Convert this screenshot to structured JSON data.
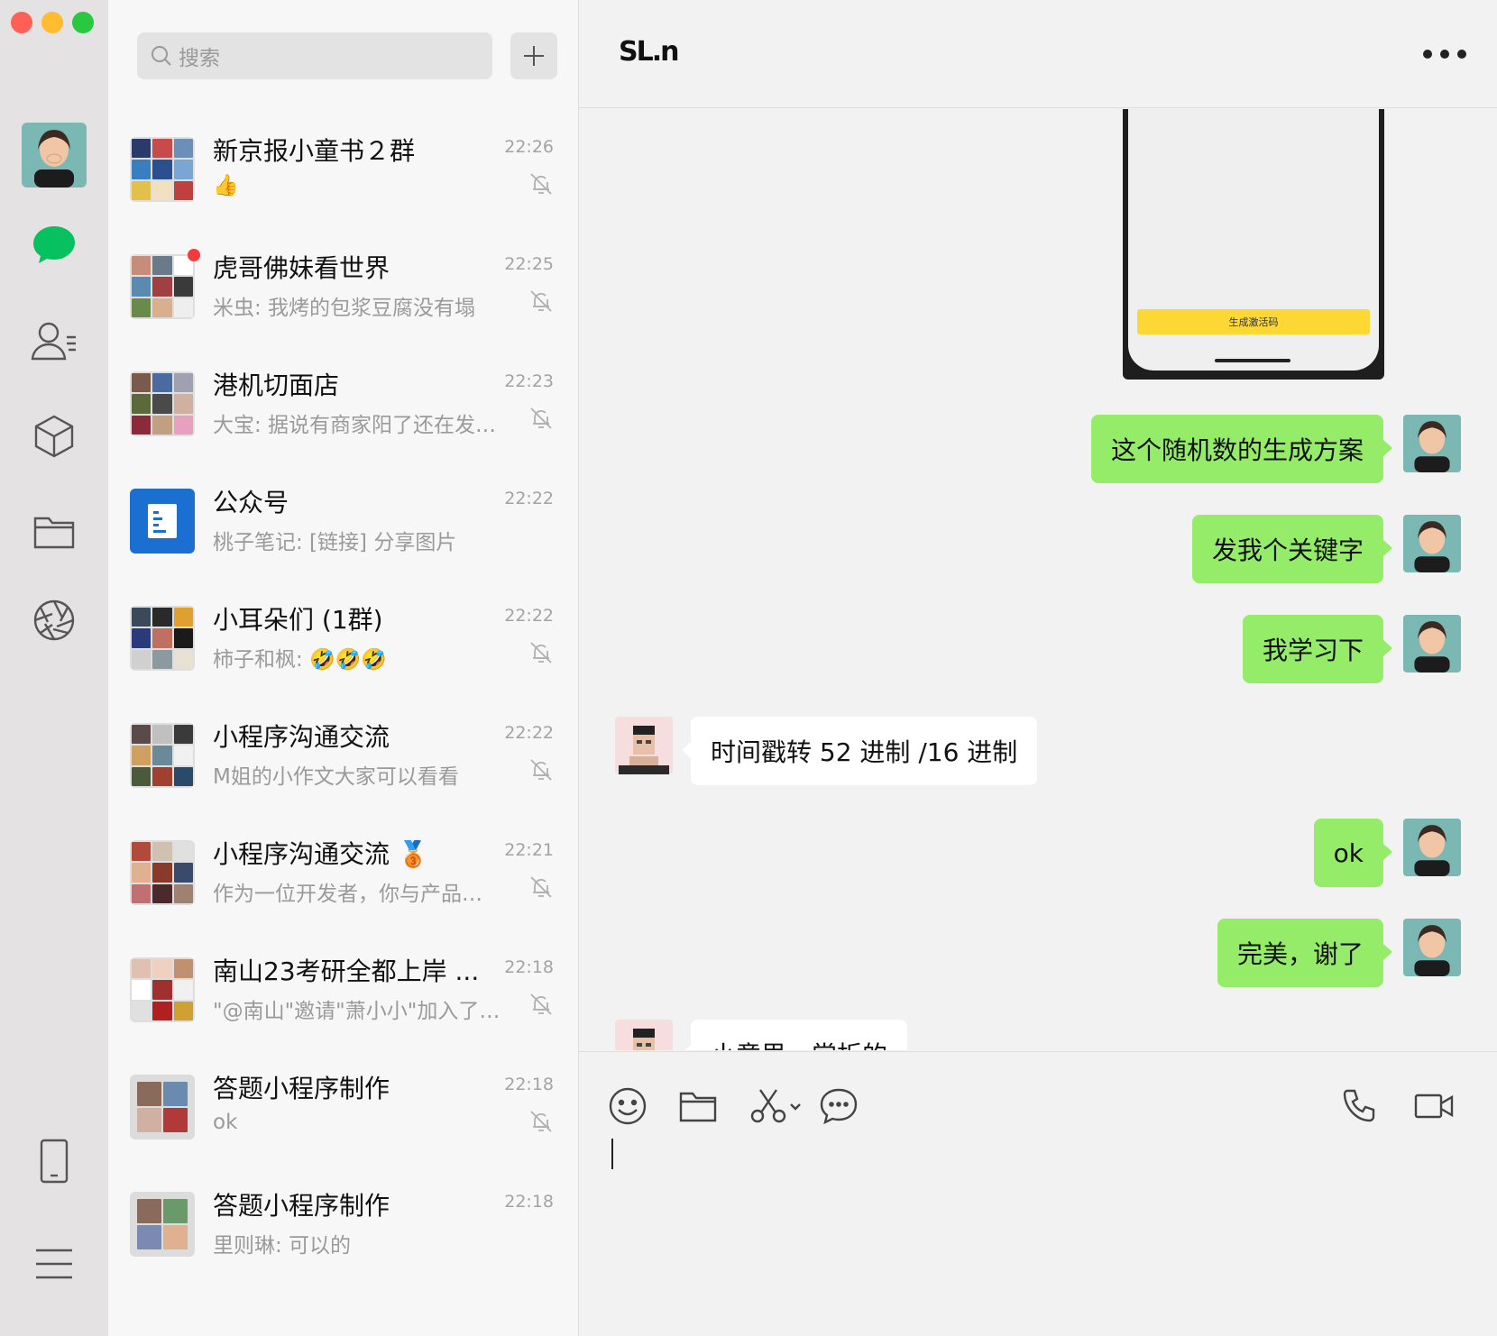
{
  "window": {
    "traffic_colors": [
      "#fe5f57",
      "#febc2e",
      "#28c840"
    ]
  },
  "search": {
    "placeholder": "搜索"
  },
  "rail": {
    "active_color": "#07c160"
  },
  "chats": [
    {
      "name": "新京报小童书２群",
      "preview": "👍",
      "time": "22:26",
      "muted": true
    },
    {
      "name": "虎哥佛妹看世界",
      "preview": "米虫: 我烤的包浆豆腐没有塌",
      "time": "22:25",
      "muted": true,
      "unread": true
    },
    {
      "name": "港机切面店",
      "preview": "大宝: 据说有商家阳了还在发…",
      "time": "22:23",
      "muted": true
    },
    {
      "name": "公众号",
      "preview": "桃子笔记: [链接] 分享图片",
      "time": "22:22",
      "muted": false
    },
    {
      "name": "小耳朵们 (1群)",
      "preview": "柿子和枫: 🤣🤣🤣",
      "time": "22:22",
      "muted": true
    },
    {
      "name": "小程序沟通交流",
      "preview": "M姐的小作文大家可以看看",
      "time": "22:22",
      "muted": true
    },
    {
      "name": "小程序沟通交流 🥉",
      "preview": "作为一位开发者，你与产品…",
      "time": "22:21",
      "muted": true
    },
    {
      "name": "南山23考研全都上岸 ...",
      "preview": "\"@南山\"邀请\"萧小小\"加入了…",
      "time": "22:18",
      "muted": true
    },
    {
      "name": "答题小程序制作",
      "preview": "ok",
      "time": "22:18",
      "muted": true
    },
    {
      "name": "答题小程序制作",
      "preview": "里则琳: 可以的",
      "time": "22:18",
      "muted": false
    }
  ],
  "conversation": {
    "title": "SL.n",
    "phone_button_label": "生成激活码",
    "messages": [
      {
        "from": "me",
        "text": "这个随机数的生成方案"
      },
      {
        "from": "me",
        "text": "发我个关键字"
      },
      {
        "from": "me",
        "text": "我学习下"
      },
      {
        "from": "them",
        "text": "时间戳转 52 进制 /16 进制"
      },
      {
        "from": "me",
        "text": "ok"
      },
      {
        "from": "me",
        "text": "完美，谢了"
      },
      {
        "from": "them",
        "text": "小意思，常折的"
      }
    ]
  },
  "colors": {
    "bubble_me": "#95ec69",
    "bubble_them": "#ffffff",
    "unread": "#f43a3a"
  }
}
